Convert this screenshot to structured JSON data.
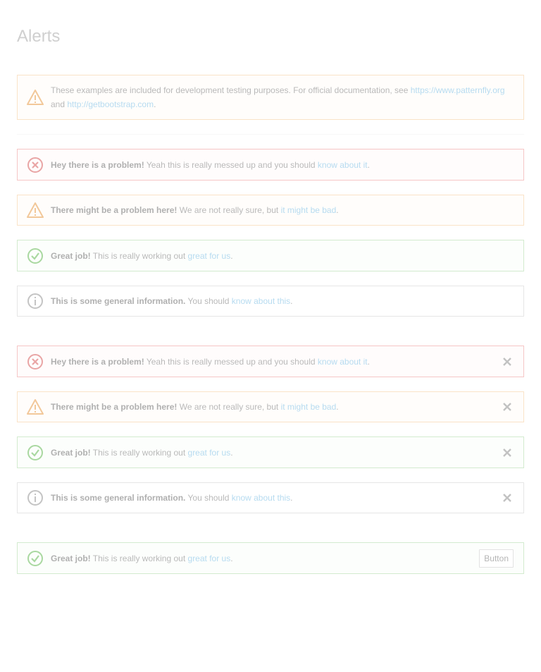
{
  "page": {
    "title": "Alerts"
  },
  "intro": {
    "text_before": "These examples are included for development testing purposes. For official documentation, see ",
    "link1": "https://www.patternfly.org",
    "text_middle": " and ",
    "link2": "http://getbootstrap.com",
    "text_after": "."
  },
  "messages": {
    "danger": {
      "strong": "Hey there is a problem!",
      "text": " Yeah this is really messed up and you should ",
      "link": "know about it",
      "end": "."
    },
    "warning": {
      "strong": "There might be a problem here!",
      "text": " We are not really sure, but ",
      "link": "it might be bad",
      "end": "."
    },
    "success": {
      "strong": "Great job!",
      "text": " This is really working out ",
      "link": "great for us",
      "end": "."
    },
    "info": {
      "strong": "This is some general information.",
      "text": " You should ",
      "link": "know about this",
      "end": "."
    }
  },
  "action_alert": {
    "button_label": "Button"
  },
  "colors": {
    "danger": "#e9a5a5",
    "warning": "#f2c89a",
    "success": "#a9d8a0",
    "info": "#c4c4c4",
    "link": "#b6dbf0"
  },
  "icons": {
    "danger": "error-circle-icon",
    "warning": "warning-triangle-icon",
    "success": "ok-circle-icon",
    "info": "info-circle-icon",
    "close": "close-icon"
  }
}
